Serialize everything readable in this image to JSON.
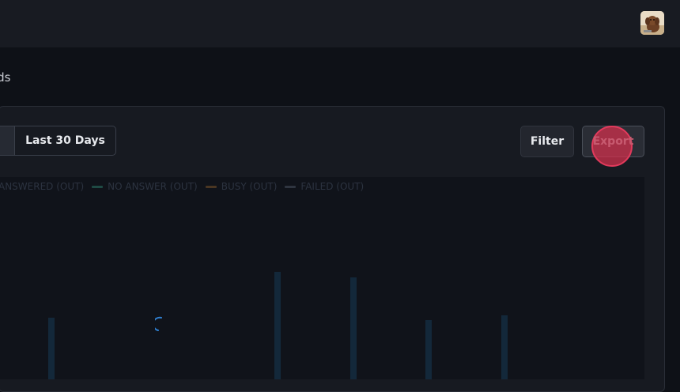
{
  "page": {
    "title_fragment": "ords"
  },
  "toolbar": {
    "range_prev_label": "",
    "range_last30_label": "Last 30 Days",
    "filter_label": "Filter",
    "export_label": "Export"
  },
  "chart": {
    "legend": [
      {
        "label": "ANSWERED (OUT)",
        "color": "#1a2a33"
      },
      {
        "label": "NO ANSWER (OUT)",
        "color": "#1f4a44"
      },
      {
        "label": "BUSY (OUT)",
        "color": "#4a3622"
      },
      {
        "label": "FAILED (OUT)",
        "color": "#2f3540"
      }
    ],
    "bar_color": "#13283a",
    "spinner_color": "#2f7fd0"
  },
  "colors": {
    "background": "#0e1117",
    "topbar": "#181b22",
    "panel": "#171a21",
    "accent_click": "#e23a5c"
  }
}
